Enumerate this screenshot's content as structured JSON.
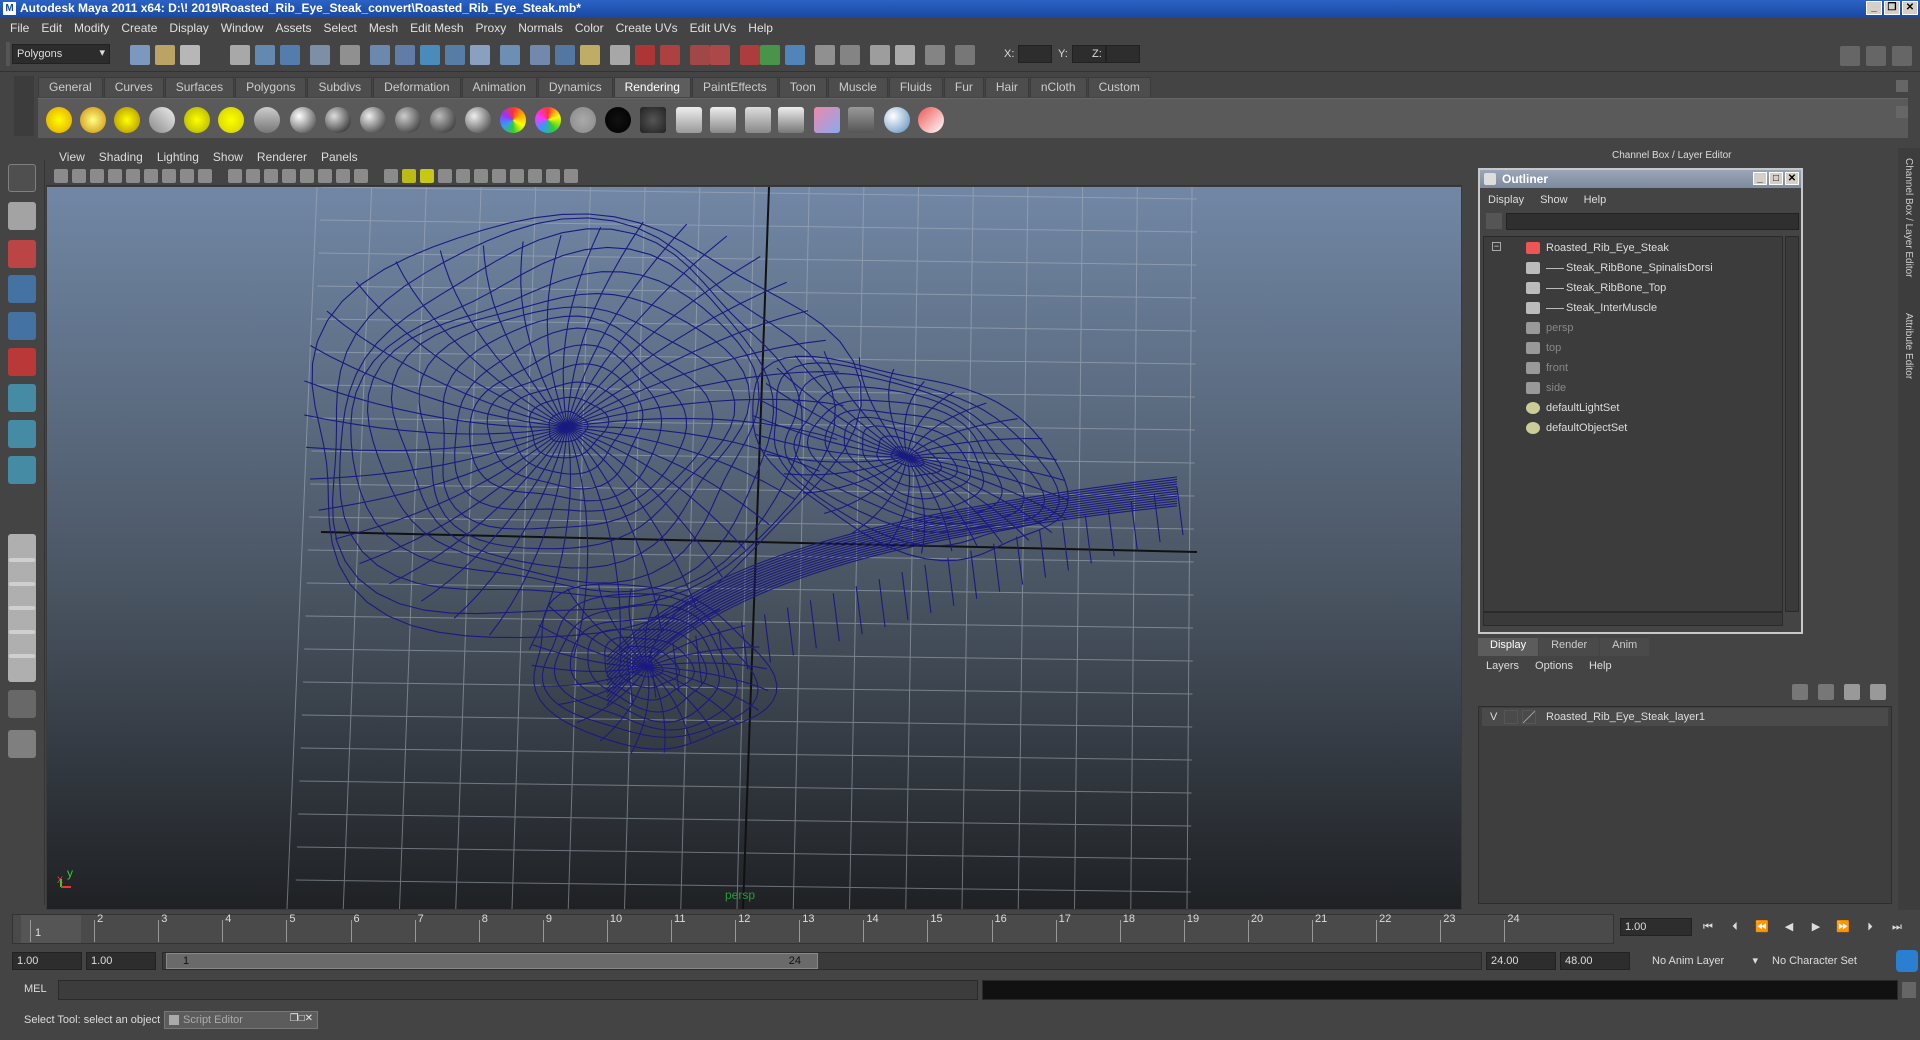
{
  "window": {
    "title": "Autodesk Maya 2011 x64: D:\\! 2019\\Roasted_Rib_Eye_Steak_convert\\Roasted_Rib_Eye_Steak.mb*"
  },
  "menubar": [
    "File",
    "Edit",
    "Modify",
    "Create",
    "Display",
    "Window",
    "Assets",
    "Select",
    "Mesh",
    "Edit Mesh",
    "Proxy",
    "Normals",
    "Color",
    "Create UVs",
    "Edit UVs",
    "Help"
  ],
  "status": {
    "mode": "Polygons",
    "x_label": "X:",
    "y_label": "Y:",
    "z_label": "Z:"
  },
  "shelf_tabs": [
    "General",
    "Curves",
    "Surfaces",
    "Polygons",
    "Subdivs",
    "Deformation",
    "Animation",
    "Dynamics",
    "Rendering",
    "PaintEffects",
    "Toon",
    "Muscle",
    "Fluids",
    "Fur",
    "Hair",
    "nCloth",
    "Custom"
  ],
  "active_shelf": "Rendering",
  "viewport": {
    "menu": [
      "View",
      "Shading",
      "Lighting",
      "Show",
      "Renderer",
      "Panels"
    ],
    "camera_label": "persp",
    "axis_x": "x",
    "axis_y": "y"
  },
  "channel_box_title": "Channel Box / Layer Editor",
  "outliner": {
    "title": "Outliner",
    "menu": [
      "Display",
      "Show",
      "Help"
    ],
    "items": [
      {
        "label": "Roasted_Rib_Eye_Steak",
        "depth": 0,
        "dim": false,
        "type": "group"
      },
      {
        "label": "Steak_RibBone_SpinalisDorsi",
        "depth": 1,
        "dim": false,
        "type": "mesh"
      },
      {
        "label": "Steak_RibBone_Top",
        "depth": 1,
        "dim": false,
        "type": "mesh"
      },
      {
        "label": "Steak_InterMuscle",
        "depth": 1,
        "dim": false,
        "type": "mesh"
      },
      {
        "label": "persp",
        "depth": 0,
        "dim": true,
        "type": "camera"
      },
      {
        "label": "top",
        "depth": 0,
        "dim": true,
        "type": "camera"
      },
      {
        "label": "front",
        "depth": 0,
        "dim": true,
        "type": "camera"
      },
      {
        "label": "side",
        "depth": 0,
        "dim": true,
        "type": "camera"
      },
      {
        "label": "defaultLightSet",
        "depth": 0,
        "dim": false,
        "type": "set"
      },
      {
        "label": "defaultObjectSet",
        "depth": 0,
        "dim": false,
        "type": "set"
      }
    ]
  },
  "layer_editor": {
    "tabs": [
      "Display",
      "Render",
      "Anim"
    ],
    "active_tab": "Display",
    "menu": [
      "Layers",
      "Options",
      "Help"
    ],
    "layer": {
      "visibility": "V",
      "name": "Roasted_Rib_Eye_Steak_layer1"
    }
  },
  "side_tabs": [
    "Channel Box / Layer Editor",
    "Attribute Editor"
  ],
  "timeline": {
    "ticks": [
      "1",
      "2",
      "3",
      "4",
      "5",
      "6",
      "7",
      "8",
      "9",
      "10",
      "11",
      "12",
      "13",
      "14",
      "15",
      "16",
      "17",
      "18",
      "19",
      "20",
      "21",
      "22",
      "23",
      "24"
    ],
    "current_frame_marker": "1",
    "current_time": "1.00"
  },
  "range": {
    "start": "1.00",
    "playback_start": "1.00",
    "slider_start": "1",
    "slider_end": "24",
    "playback_end": "24.00",
    "end": "48.00",
    "anim_layer": "No Anim Layer",
    "character_set": "No Character Set"
  },
  "command": {
    "label": "MEL"
  },
  "help": {
    "text": "Select Tool: select an object",
    "script_editor": "Script Editor"
  }
}
